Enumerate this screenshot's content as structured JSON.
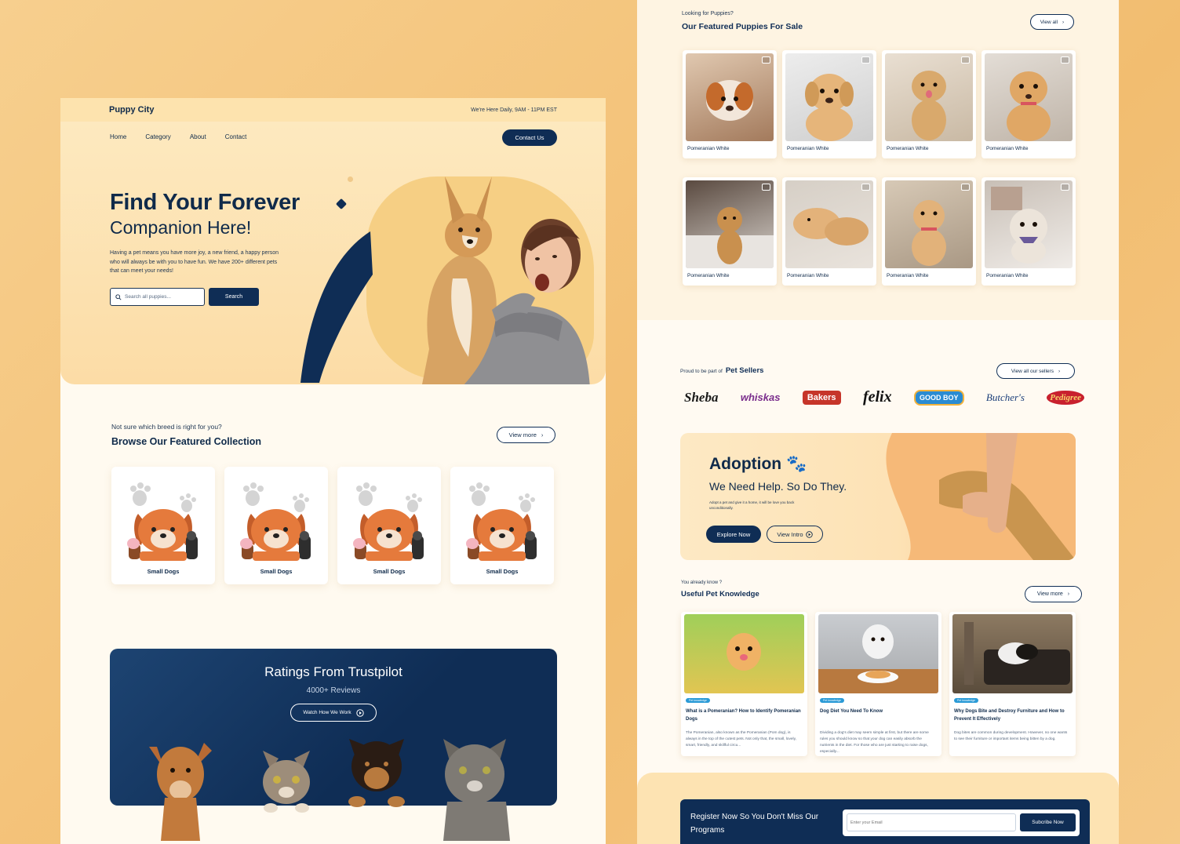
{
  "left": {
    "brand": "Puppy City",
    "hours": "We're Here Daily, 9AM - 11PM EST",
    "nav": [
      "Home",
      "Category",
      "About",
      "Contact"
    ],
    "contact_btn": "Contact Us",
    "hero_title_1": "Find Your Forever",
    "hero_title_2": "Companion Here!",
    "hero_desc": "Having a pet means you have more joy, a new friend, a happy person who will always be with you to have fun. We have 200+ different pets that can meet your needs!",
    "search_placeholder": "Search all puppies...",
    "search_btn": "Search",
    "browse_q": "Not sure which breed is right for you?",
    "browse_title": "Browse Our Featured Collection",
    "view_more": "View more",
    "breeds": [
      "Small Dogs",
      "Small Dogs",
      "Small Dogs",
      "Small Dogs"
    ],
    "trust_title": "Ratings From Trustpilot",
    "trust_sub": "4000+ Reviews",
    "watch_btn": "Watch How We Work"
  },
  "right": {
    "puppies_q": "Looking for Puppies?",
    "puppies_title": "Our Featured Puppies For Sale",
    "view_all": "View all",
    "puppies": [
      "Pomeranian White",
      "Pomeranian White",
      "Pomeranian White",
      "Pomeranian White",
      "Pomeranian White",
      "Pomeranian White",
      "Pomeranian White",
      "Pomeranian White"
    ],
    "sellers_prefix": "Proud to be part of",
    "sellers_title": "Pet Sellers",
    "view_sellers": "View all our sellers",
    "seller_logos": [
      "Sheba",
      "whiskas",
      "Bakers",
      "felix",
      "GOOD BOY",
      "Butcher's",
      "Pedigree"
    ],
    "adopt_title": "Adoption",
    "adopt_sub": "We Need Help. So Do They.",
    "adopt_desc": "Adopt a pet and give it a home, it will be love you back unconditionally.",
    "explore_btn": "Explore Now",
    "intro_btn": "View Intro",
    "know_q": "You already know ?",
    "know_title": "Useful Pet Knowledge",
    "know_view_more": "View more",
    "articles": [
      {
        "tag": "Pet knowledge",
        "title": "What is a Pomeranian? How to Identify Pomeranian Dogs",
        "desc": "The Pomeranian, also known as the Pomeranian (Pom dog), is always in the top of the cutest pets. Not only that, the small, lovely, smart, friendly, and skillful circu..."
      },
      {
        "tag": "Pet knowledge",
        "title": "Dog Diet You Need To Know",
        "desc": "Dividing a dog's diet may seem simple at first, but there are some rules you should know so that your dog can easily absorb the nutrients in the diet. For those who are just starting to raise dogs, especially..."
      },
      {
        "tag": "Pet knowledge",
        "title": "Why Dogs Bite and Destroy Furniture and How to Prevent It Effectively",
        "desc": "Dog bites are common during development. However, no one wants to see their furniture or important items being bitten by a dog."
      }
    ],
    "register_title": "Register Now So You Don't Miss Our Programs",
    "email_placeholder": "Enter your Email",
    "subscribe_btn": "Subcribe Now"
  },
  "colors": {
    "navy": "#0f2d55",
    "cream": "#fde9bf",
    "orange": "#f2bd70",
    "tag_blue": "#2a9ad6"
  }
}
